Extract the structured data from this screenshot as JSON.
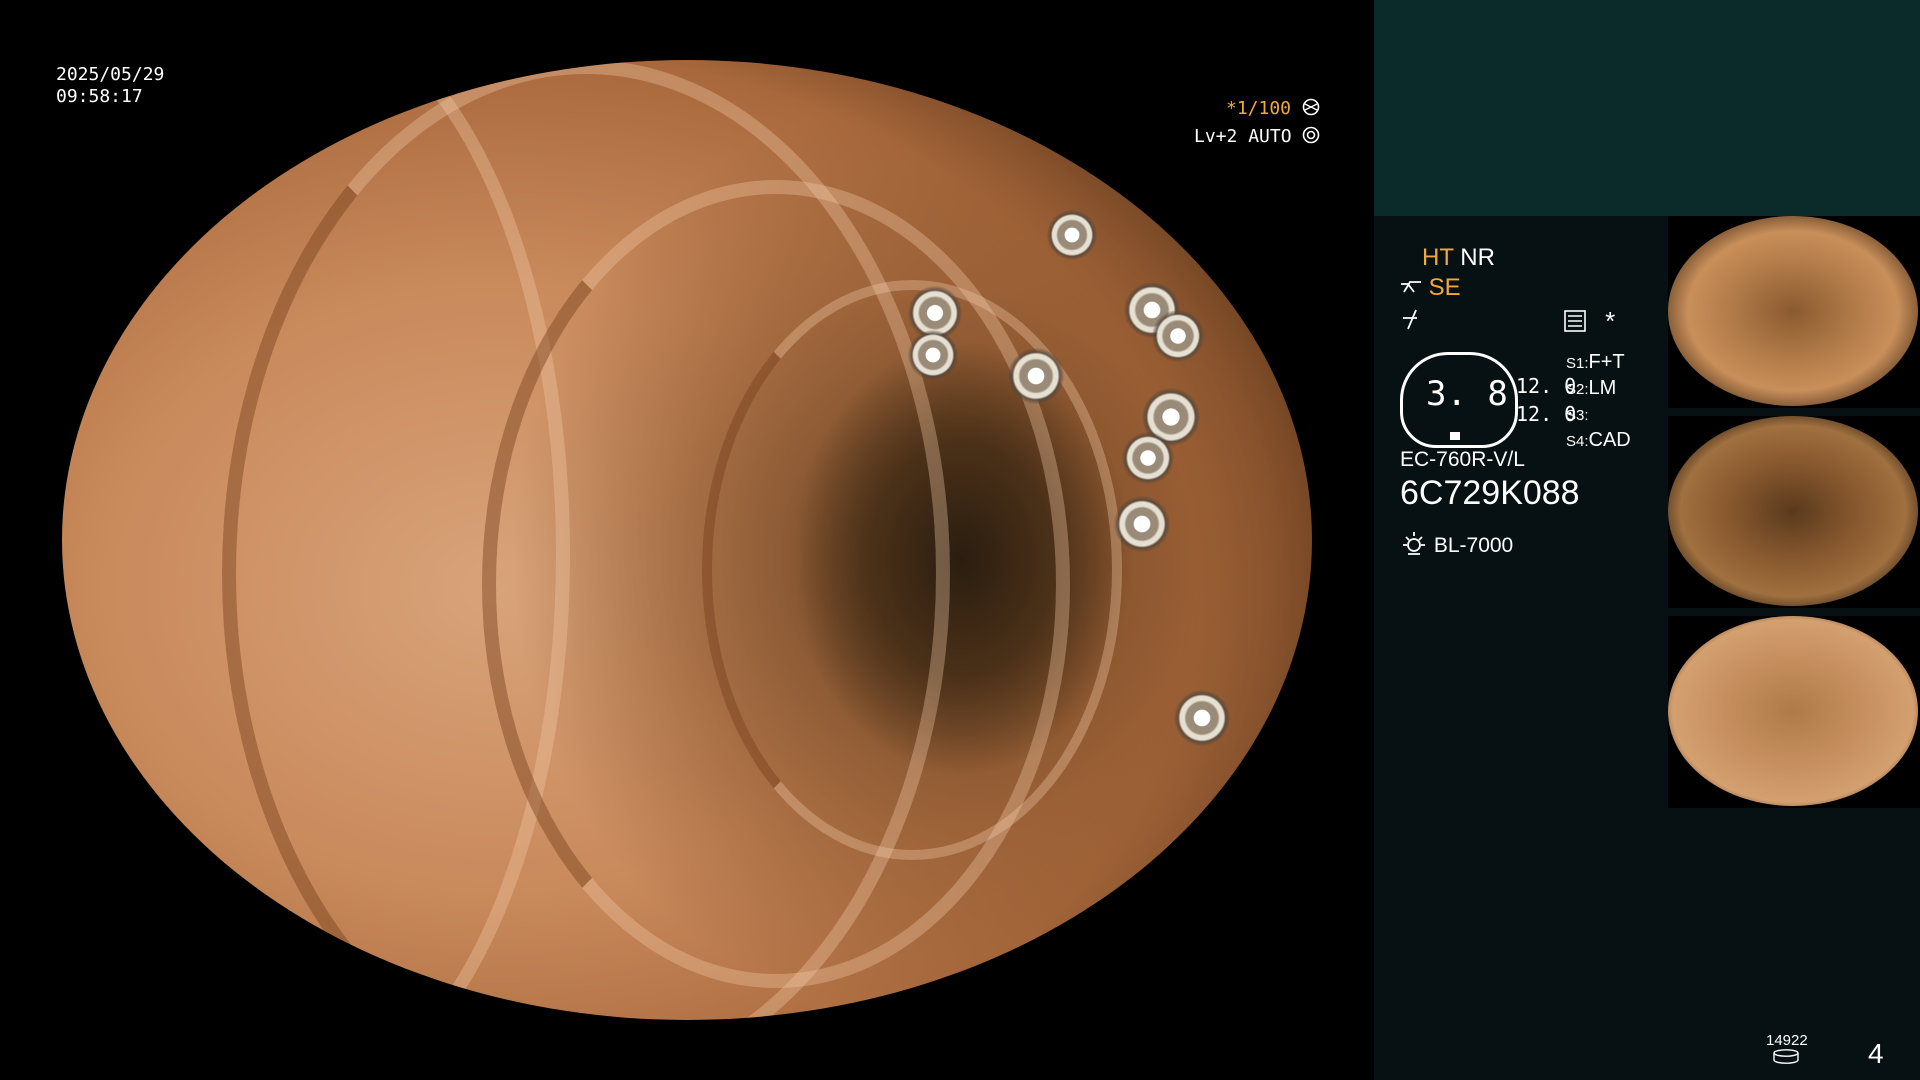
{
  "overlay": {
    "date": "2025/05/29",
    "time": "09:58:17",
    "shutter": "*1/100",
    "level": "Lv+2",
    "auto": "AUTO"
  },
  "panel": {
    "ht": "HT",
    "nr": "NR",
    "se": "SE",
    "asterisk": "*",
    "gauge_value": "3. 8",
    "value_1": "12. 0",
    "value_2": "12. 0",
    "s1_label": "S1:",
    "s1_value": "F+T",
    "s2_label": "S2:",
    "s2_value": "LM",
    "s3_label": "S3:",
    "s3_value": "",
    "s4_label": "S4:",
    "s4_value": "CAD",
    "scope_model": "EC-760R-V/L",
    "scope_serial": "6C729K088",
    "light_source": "BL-7000",
    "counter": "14922",
    "page_number": "4"
  },
  "colors": {
    "accent": "#f2a93b",
    "panel_bg": "#071012",
    "panel_top_bg": "#0b2a2a"
  },
  "icons": [
    "shutter-icon",
    "auto-iris-icon",
    "structure-enhance-icon",
    "color-mode-icon",
    "settings-list-icon",
    "lamp-icon",
    "disk-icon"
  ]
}
